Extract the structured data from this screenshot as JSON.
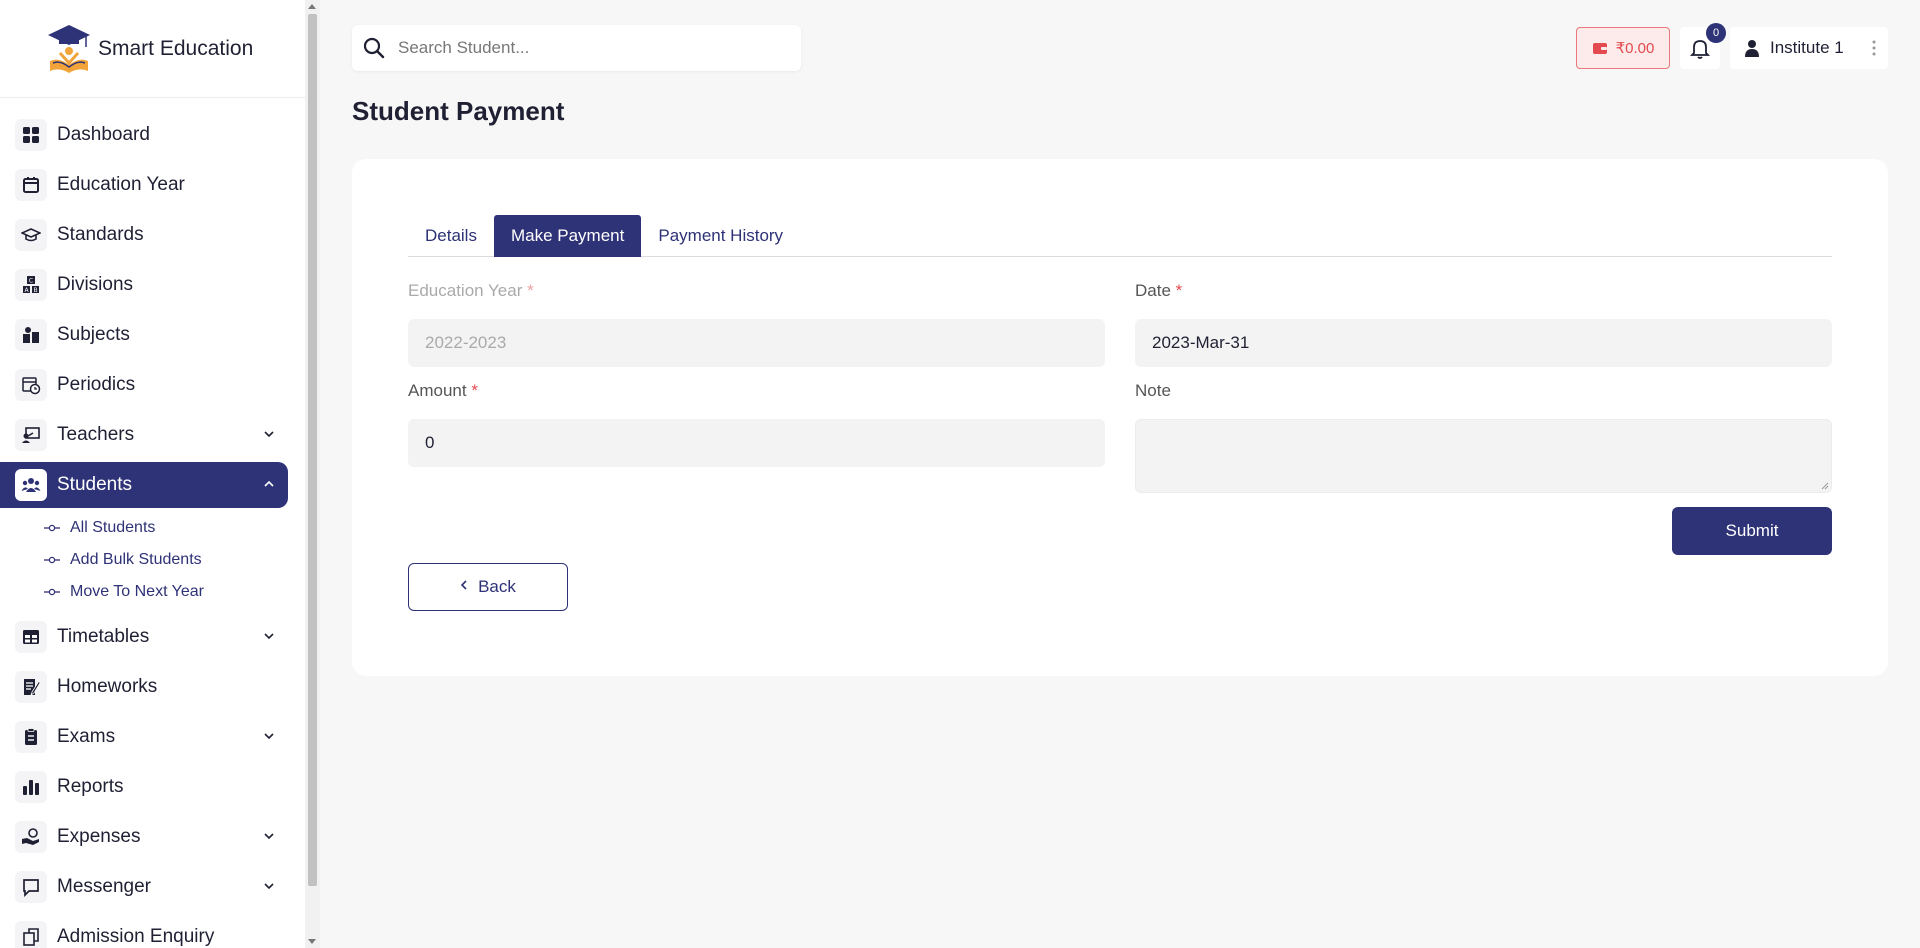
{
  "brand": {
    "name": "Smart Education"
  },
  "sidebar": {
    "items": [
      {
        "label": "Dashboard",
        "icon": "dashboard-grid-icon"
      },
      {
        "label": "Education Year",
        "icon": "calendar-icon"
      },
      {
        "label": "Standards",
        "icon": "graduation-cap-icon"
      },
      {
        "label": "Divisions",
        "icon": "abc-blocks-icon"
      },
      {
        "label": "Subjects",
        "icon": "books-icon"
      },
      {
        "label": "Periodics",
        "icon": "calendar-clock-icon"
      },
      {
        "label": "Teachers",
        "icon": "teacher-board-icon",
        "expandable": true
      },
      {
        "label": "Students",
        "icon": "users-group-icon",
        "expandable": true,
        "active": true
      },
      {
        "label": "Timetables",
        "icon": "table-icon",
        "expandable": true
      },
      {
        "label": "Homeworks",
        "icon": "notebook-pen-icon"
      },
      {
        "label": "Exams",
        "icon": "clipboard-icon",
        "expandable": true
      },
      {
        "label": "Reports",
        "icon": "bar-chart-icon"
      },
      {
        "label": "Expenses",
        "icon": "hand-money-icon",
        "expandable": true
      },
      {
        "label": "Messenger",
        "icon": "chat-bubble-icon",
        "expandable": true
      },
      {
        "label": "Admission Enquiry",
        "icon": "enquiry-icon"
      }
    ],
    "students_sub": [
      "All Students",
      "Add Bulk Students",
      "Move To Next Year"
    ]
  },
  "header": {
    "search_placeholder": "Search Student...",
    "wallet": "₹0.00",
    "notifications": "0",
    "user": "Institute 1"
  },
  "page": {
    "title": "Student Payment"
  },
  "tabs": [
    {
      "label": "Details",
      "active": false
    },
    {
      "label": "Make Payment",
      "active": true
    },
    {
      "label": "Payment History",
      "active": false
    }
  ],
  "form": {
    "education_year": {
      "label": "Education Year",
      "value": "2022-2023",
      "disabled": true
    },
    "date": {
      "label": "Date",
      "value": "2023-Mar-31"
    },
    "amount": {
      "label": "Amount",
      "value": "0"
    },
    "note": {
      "label": "Note",
      "value": ""
    },
    "required_mark": "*",
    "submit_label": "Submit",
    "back_label": "Back"
  },
  "colors": {
    "primary": "#2e3276",
    "danger": "#e24a4f",
    "background": "#f7f7f7"
  }
}
